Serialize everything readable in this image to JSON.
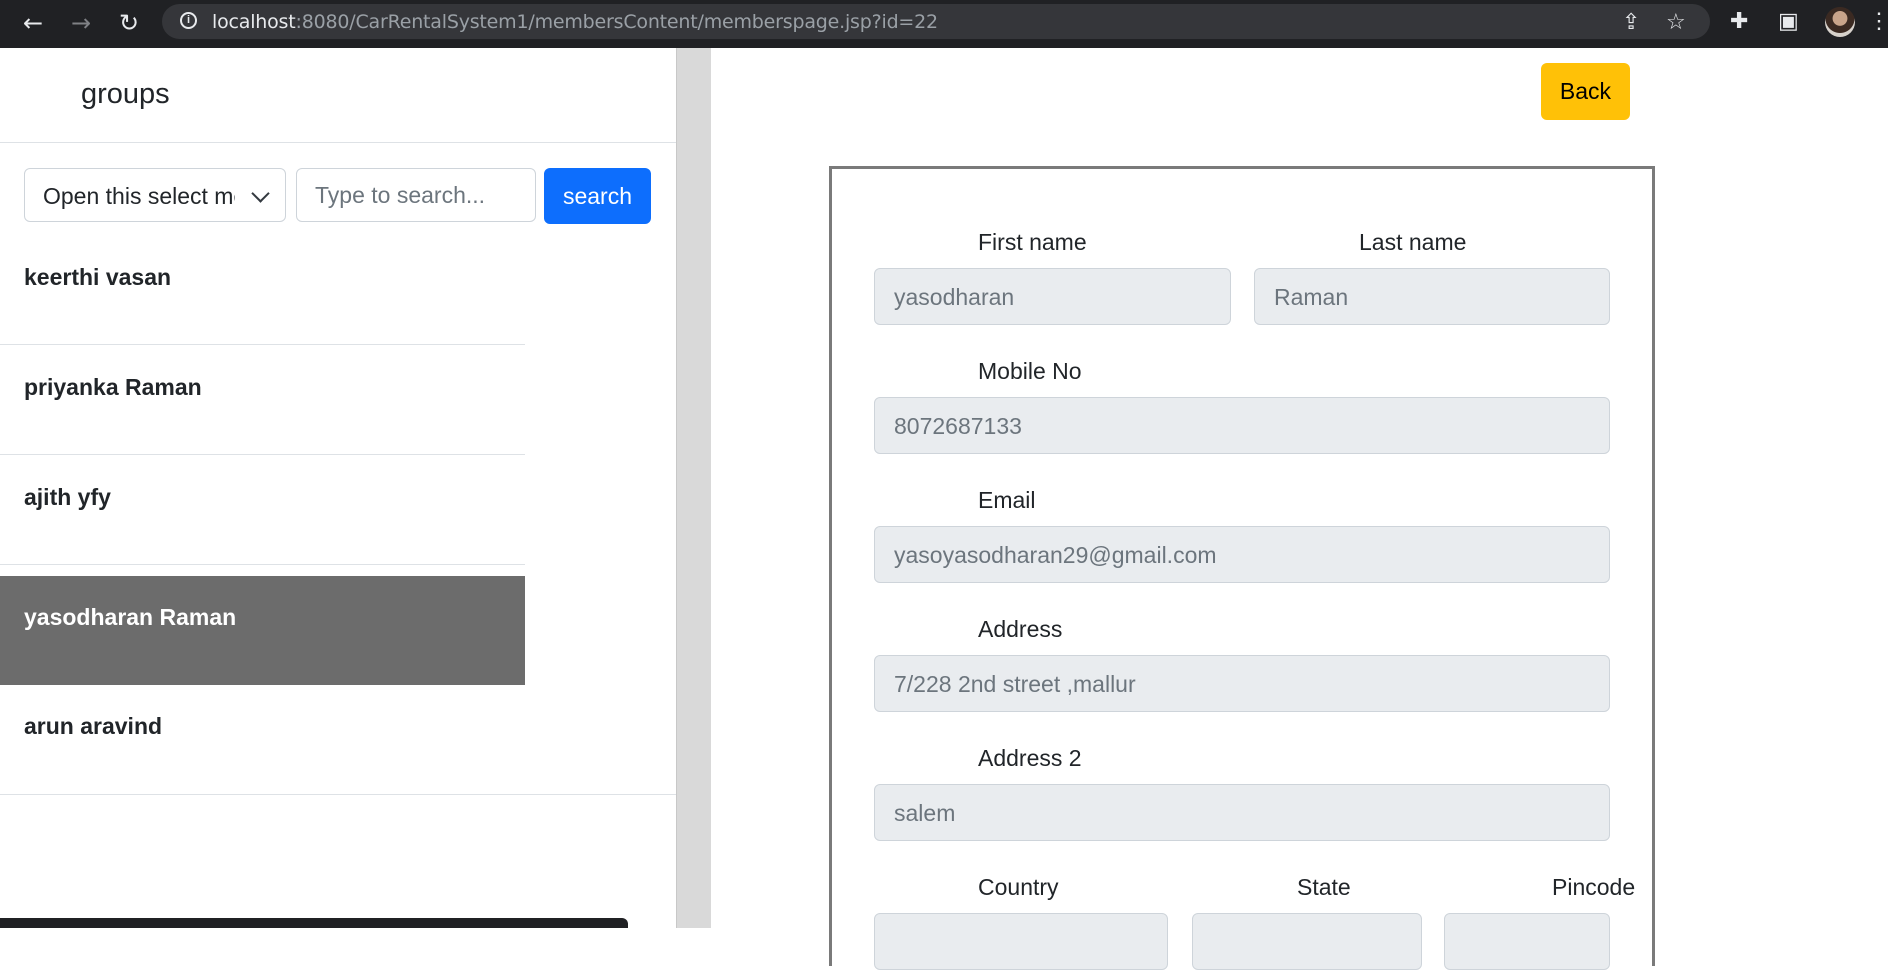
{
  "browser": {
    "url_host": "localhost",
    "url_rest": ":8080/CarRentalSystem1/membersContent/memberspage.jsp?id=22"
  },
  "left": {
    "title": "groups",
    "select_value": "Open this select menu",
    "search_placeholder": "Type to search...",
    "search_button": "search",
    "members": [
      {
        "name": "keerthi vasan"
      },
      {
        "name": "priyanka Raman"
      },
      {
        "name": "ajith yfy"
      },
      {
        "name": "yasodharan Raman"
      },
      {
        "name": "arun aravind"
      }
    ],
    "active_index": 3
  },
  "form": {
    "back_button": "Back",
    "first_name_label": "First name",
    "first_name": "yasodharan",
    "last_name_label": "Last name",
    "last_name": "Raman",
    "mobile_label": "Mobile No",
    "mobile": "8072687133",
    "email_label": "Email",
    "email": "yasoyasodharan29@gmail.com",
    "address_label": "Address",
    "address": "7/228 2nd street ,mallur",
    "address2_label": "Address 2",
    "address2": "salem",
    "country_label": "Country",
    "state_label": "State",
    "pincode_label": "Pincode"
  }
}
